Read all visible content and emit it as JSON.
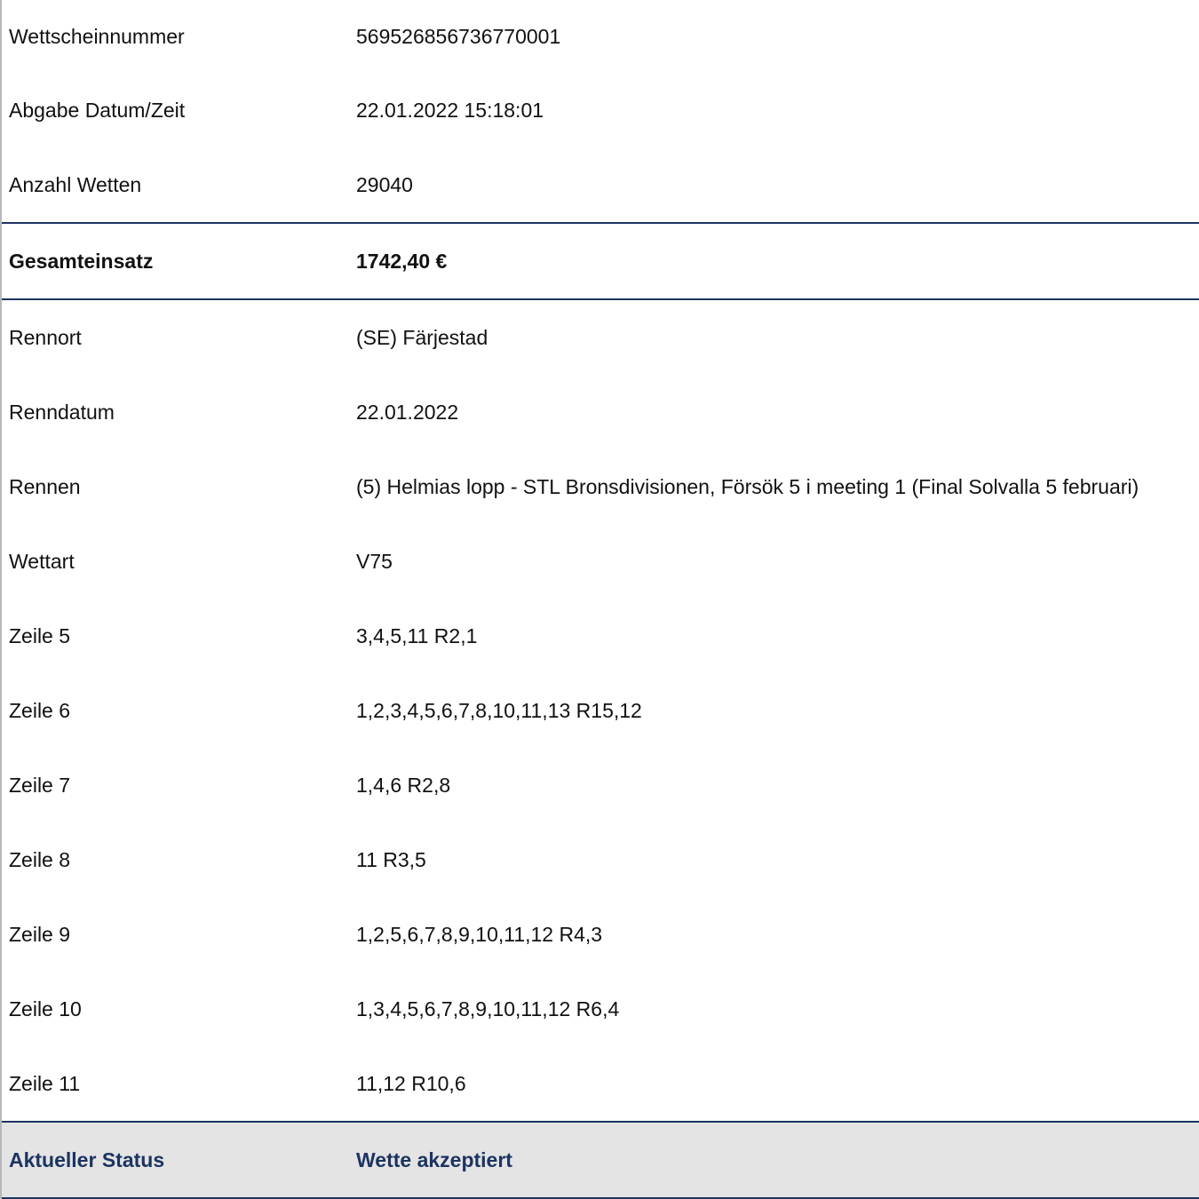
{
  "header_rows": [
    {
      "label": "Wettscheinnummer",
      "value": "569526856736770001"
    },
    {
      "label": "Abgabe Datum/Zeit",
      "value": "22.01.2022 15:18:01"
    },
    {
      "label": "Anzahl Wetten",
      "value": "29040"
    }
  ],
  "total": {
    "label": "Gesamteinsatz",
    "value": "1742,40 €"
  },
  "detail_rows": [
    {
      "label": "Rennort",
      "value": "(SE) Färjestad"
    },
    {
      "label": "Renndatum",
      "value": "22.01.2022"
    },
    {
      "label": "Rennen",
      "value": "(5) Helmias lopp - STL Bronsdivisionen, Försök 5 i meeting 1 (Final Solvalla 5 februari)"
    },
    {
      "label": "Wettart",
      "value": "V75"
    },
    {
      "label": "Zeile 5",
      "value": "3,4,5,11 R2,1"
    },
    {
      "label": "Zeile 6",
      "value": "1,2,3,4,5,6,7,8,10,11,13 R15,12"
    },
    {
      "label": "Zeile 7",
      "value": "1,4,6 R2,8"
    },
    {
      "label": "Zeile 8",
      "value": "11 R3,5"
    },
    {
      "label": "Zeile 9",
      "value": "1,2,5,6,7,8,9,10,11,12 R4,3"
    },
    {
      "label": "Zeile 10",
      "value": "1,3,4,5,6,7,8,9,10,11,12 R6,4"
    },
    {
      "label": "Zeile 11",
      "value": "11,12 R10,6"
    }
  ],
  "status": {
    "label": "Aktueller Status",
    "value": "Wette akzeptiert"
  },
  "colors": {
    "accent": "#1c3461",
    "status_background": "#e4e4e4",
    "left_border": "#b8b8b8"
  }
}
